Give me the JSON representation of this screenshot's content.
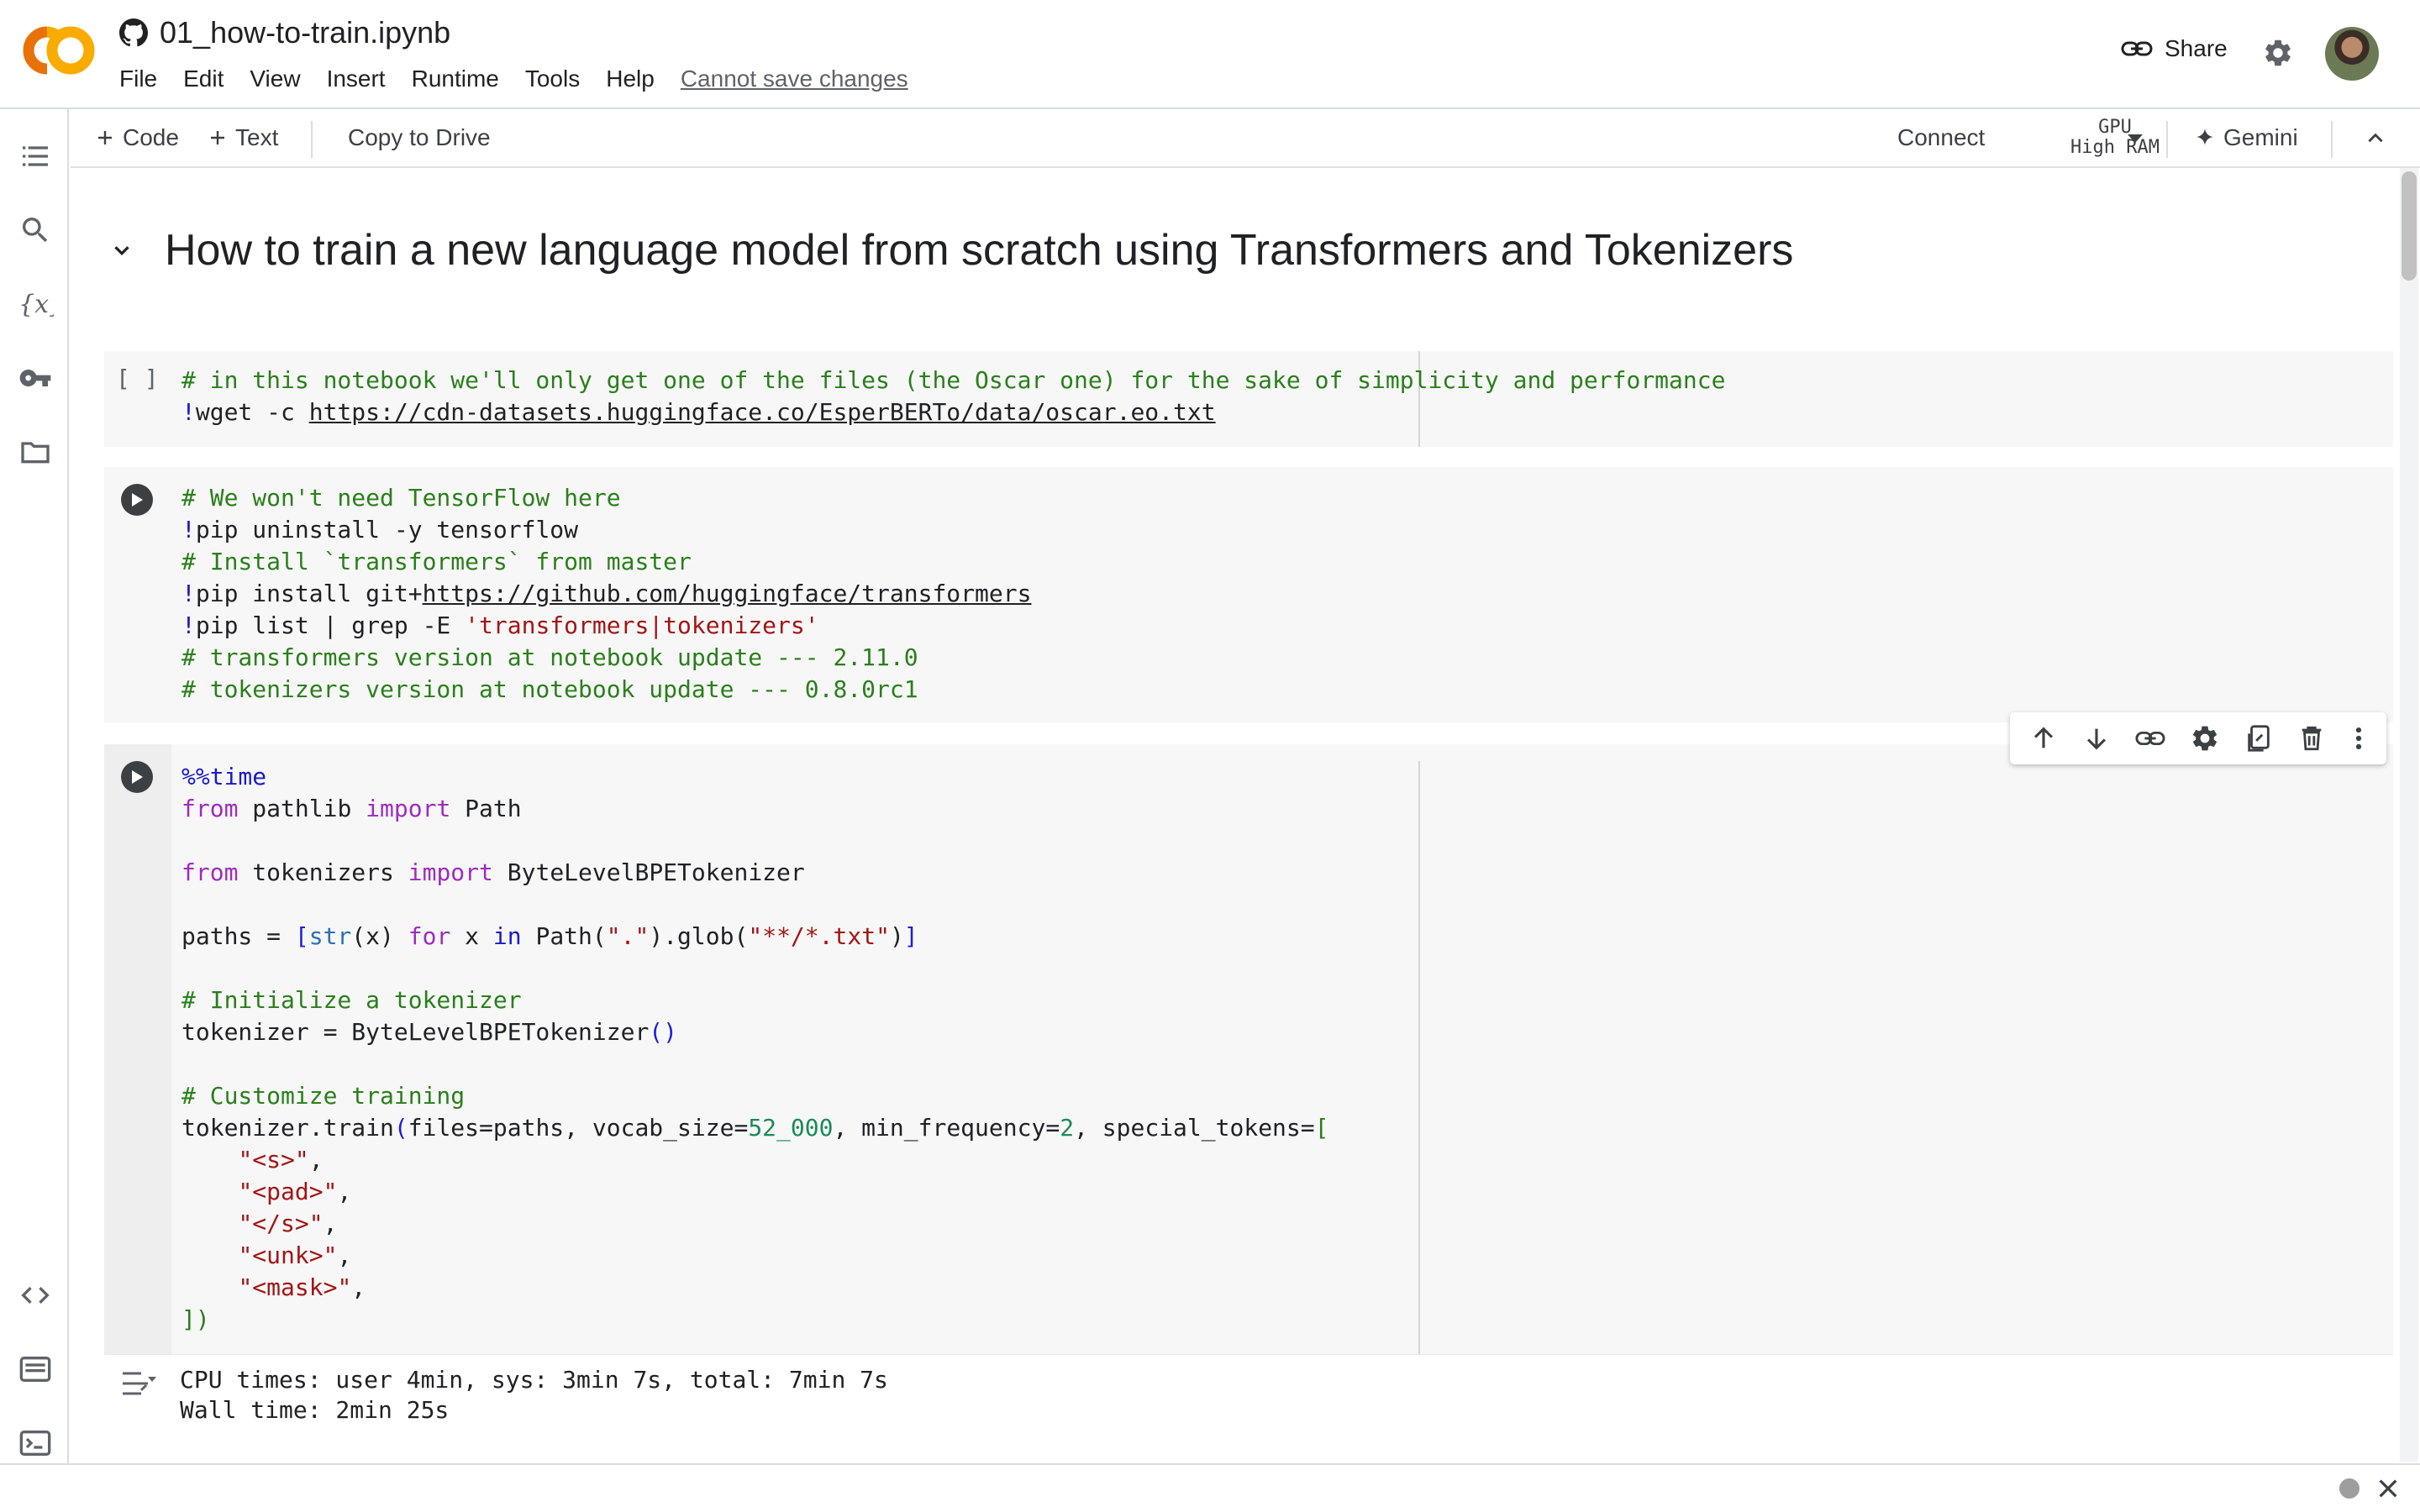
{
  "app": {
    "logo": "colab-logo",
    "notebook_title": "01_how-to-train.ipynb",
    "title_icon": "github-icon"
  },
  "menu": [
    "File",
    "Edit",
    "View",
    "Insert",
    "Runtime",
    "Tools",
    "Help"
  ],
  "save_status": "Cannot save changes",
  "header": {
    "share_label": "Share",
    "share_icon": "link-icon",
    "settings_icon": "gear-icon"
  },
  "sidebar_icons": [
    "table-of-contents-icon",
    "search-icon",
    "variables-icon",
    "secrets-key-icon",
    "files-folder-icon",
    "code-snippets-icon",
    "command-palette-icon",
    "terminal-icon"
  ],
  "toolbar": {
    "code_label": "Code",
    "text_label": "Text",
    "copy_label": "Copy to Drive",
    "connect_label": "Connect",
    "runtime_type": "GPU",
    "runtime_ram": "High RAM",
    "gemini_label": "Gemini"
  },
  "section": {
    "heading": "How to train a new language model from scratch using Transformers and Tokenizers"
  },
  "cells": {
    "c1": {
      "exec_marker": "[ ]",
      "line1": "# in this notebook we'll only get one of the files (the Oscar one) for the sake of simplicity and performance",
      "line2_cmd": "wget -c ",
      "line2_url": "https://cdn-datasets.huggingface.co/EsperBERTo/data/oscar.eo.txt"
    },
    "c2": {
      "l1": "# We won't need TensorFlow here",
      "l2": "pip uninstall -y tensorflow",
      "l3": "# Install `transformers` from master",
      "l4_cmd": "pip install git+",
      "l4_url": "https://github.com/huggingface/transformers",
      "l5_cmd": "pip list | grep -E ",
      "l5_str": "'transformers|tokenizers'",
      "l6": "# transformers version at notebook update --- 2.11.0",
      "l7": "# tokenizers version at notebook update --- 0.8.0rc1"
    },
    "c3": {
      "magic": "%%time",
      "l2_from": "from",
      "l2_mod": " pathlib ",
      "l2_import": "import",
      "l2_name": " Path",
      "l4_from": "from",
      "l4_mod": " tokenizers ",
      "l4_import": "import",
      "l4_name": " ByteLevelBPETokenizer",
      "l6_a": "paths = ",
      "l6_b": "[",
      "l6_c": "str",
      "l6_d": "(x) ",
      "l6_e": "for",
      "l6_f": " x ",
      "l6_g": "in",
      "l6_h": " Path(",
      "l6_i": "\".\"",
      "l6_j": ").glob(",
      "l6_k": "\"**/*.txt\"",
      "l6_l": ")",
      "l6_m": "]",
      "l8": "# Initialize a tokenizer",
      "l9_a": "tokenizer = ByteLevelBPETokenizer",
      "l9_b": "()",
      "l11": "# Customize training",
      "l12_a": "tokenizer.train",
      "l12_b": "(",
      "l12_c": "files=paths, vocab_size=",
      "l12_d": "52_000",
      "l12_e": ", min_frequency=",
      "l12_f": "2",
      "l12_g": ", special_tokens=",
      "l12_h": "[",
      "tokens": [
        "\"<s>\"",
        "\"<pad>\"",
        "\"</s>\"",
        "\"<unk>\"",
        "\"<mask>\""
      ],
      "closing": "])",
      "output_line1": "CPU times: user 4min, sys: 3min 7s, total: 7min 7s",
      "output_line2": "Wall time: 2min 25s"
    }
  },
  "cell_toolbar_icons": [
    "move-up-icon",
    "move-down-icon",
    "link-icon",
    "gear-icon",
    "mirror-cell-icon",
    "delete-icon",
    "more-options-icon"
  ],
  "colors": {
    "comment": "#2a7f1b",
    "keyword": "#9f2bbf",
    "string": "#a31515",
    "number": "#1a8a57",
    "logo_orange": "#f9ab00",
    "logo_dark": "#e8710a"
  }
}
